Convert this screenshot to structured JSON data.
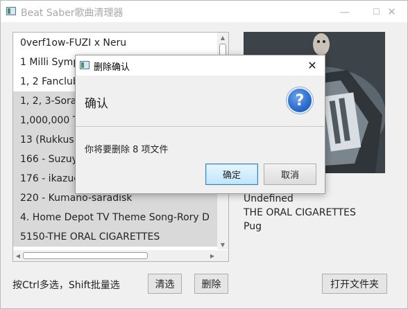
{
  "window": {
    "title": "Beat Saber歌曲清理器",
    "minimize_glyph": "—",
    "maximize_glyph": "☐",
    "close_glyph": "✕"
  },
  "song_list": {
    "items": [
      {
        "label": "0verf1ow-FUZI x Neru",
        "selected": false
      },
      {
        "label": "1 Milli Symphony",
        "selected": false
      },
      {
        "label": "1, 2 Fanclub",
        "selected": false
      },
      {
        "label": "1, 2, 3-Sora",
        "selected": true
      },
      {
        "label": "1,000,000 T",
        "selected": true
      },
      {
        "label": "13 (Rukkus)",
        "selected": true
      },
      {
        "label": "166 - Suzuya",
        "selected": true
      },
      {
        "label": "176 - ikazuchi",
        "selected": true
      },
      {
        "label": "220 - Kumano-saradisk",
        "selected": true
      },
      {
        "label": "4. Home Depot TV Theme Song-Rory D",
        "selected": true
      },
      {
        "label": "5150-THE ORAL CIGARETTES",
        "selected": true
      }
    ],
    "scroll_up_glyph": "▲",
    "scroll_down_glyph": "▼",
    "scroll_left_glyph": "◀",
    "scroll_right_glyph": "▶"
  },
  "song_info": {
    "cover_icon": "album-cover-art",
    "mapper": "Undefined",
    "artist": "THE ORAL CIGARETTES",
    "uploader": "Pug"
  },
  "footer": {
    "hint": "按Ctrl多选，Shift批量选",
    "clear_label": "清选",
    "delete_label": "删除",
    "open_folder_label": "打开文件夹"
  },
  "dialog": {
    "title": "删除确认",
    "close_glyph": "✕",
    "heading": "确认",
    "question_glyph": "?",
    "message": "你将要删除 8 项文件",
    "ok_label": "确定",
    "cancel_label": "取消"
  },
  "colors": {
    "selected_row": "#d9d9d9",
    "default_button_border": "#3c7fb1",
    "question_icon": "#2e6fd0"
  }
}
